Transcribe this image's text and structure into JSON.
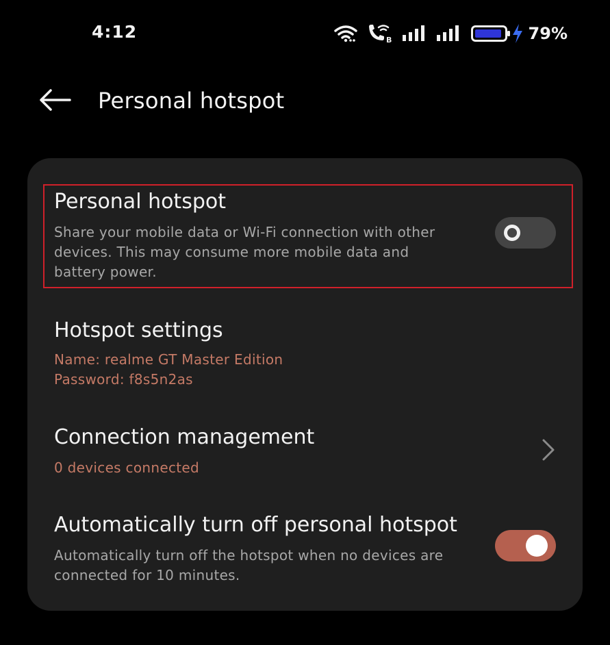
{
  "status_bar": {
    "time": "4:12",
    "battery_percent": "79%",
    "icons": [
      "wifi-icon",
      "wifi-calling-icon",
      "signal-1-icon",
      "signal-2-icon",
      "battery-icon",
      "charging-bolt-icon"
    ]
  },
  "header": {
    "back_icon": "arrow-left-icon",
    "title": "Personal hotspot"
  },
  "settings": {
    "personal_hotspot": {
      "title": "Personal hotspot",
      "description": "Share your mobile data or Wi-Fi connection with other devices. This may consume more mobile data and battery power.",
      "toggle_state": "off"
    },
    "hotspot_settings": {
      "title": "Hotspot settings",
      "name_line": "Name: realme GT Master Edition",
      "password_line": "Password: f8s5n2as"
    },
    "connection_management": {
      "title": "Connection management",
      "status": "0 devices connected",
      "chevron_icon": "chevron-right-icon"
    },
    "auto_off": {
      "title": "Automatically turn off personal hotspot",
      "description": "Automatically turn off the hotspot when no devices are connected for 10 minutes.",
      "toggle_state": "on"
    }
  },
  "colors": {
    "background": "#000000",
    "card": "#1f1f1f",
    "accent": "#c57a66",
    "toggle_on": "#b5604f",
    "toggle_off": "#444444",
    "highlight": "#d0202a",
    "battery_fill": "#2f35d8",
    "charging": "#3b6cf0"
  }
}
